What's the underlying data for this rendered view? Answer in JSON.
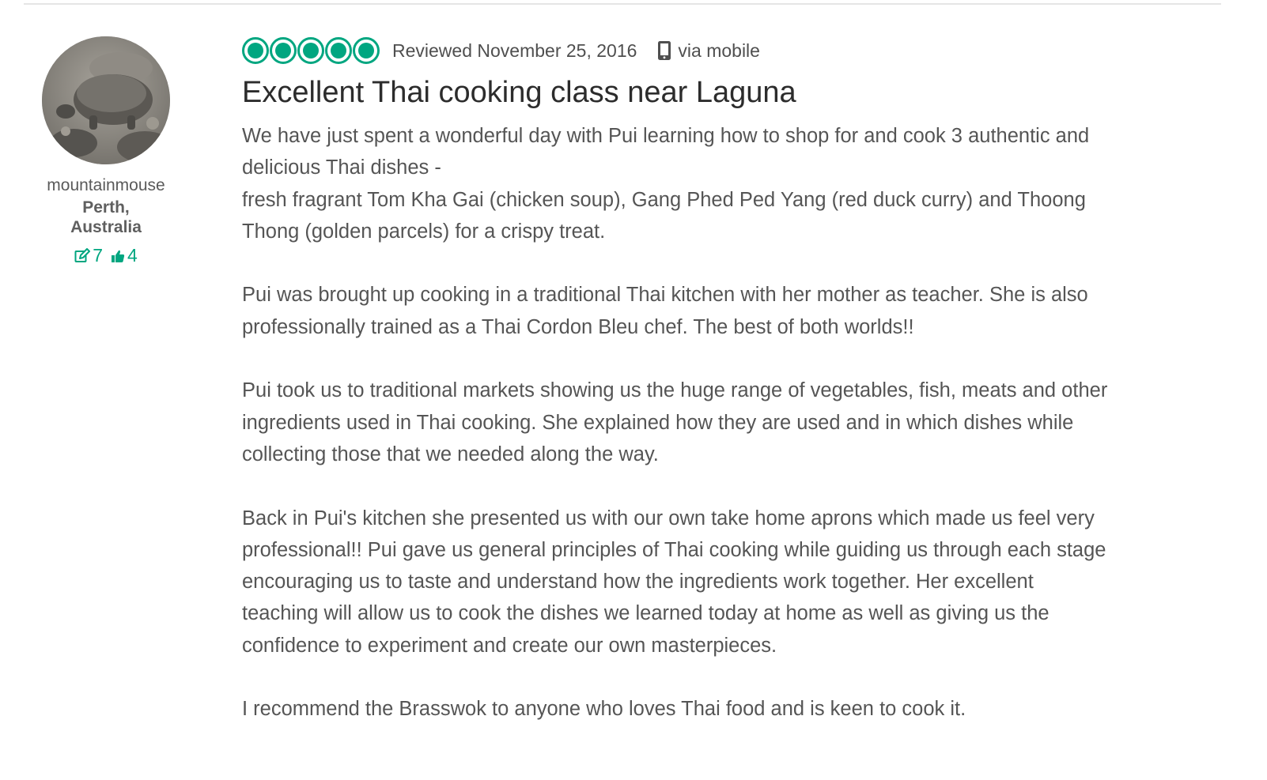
{
  "reviewer": {
    "username": "mountainmouse",
    "location": "Perth, Australia",
    "review_count": "7",
    "helpful_votes": "4"
  },
  "review": {
    "rating": 5,
    "date": "Reviewed November 25, 2016",
    "via": "via mobile",
    "title": "Excellent Thai cooking class near Laguna",
    "paragraphs": [
      "We have just spent a wonderful day with Pui learning how to shop for and cook 3 authentic and delicious Thai dishes -\nfresh fragrant Tom Kha Gai (chicken soup), Gang Phed Ped Yang (red duck curry) and Thoong Thong (golden parcels) for a crispy treat.",
      "Pui was brought up cooking in a traditional Thai kitchen with her mother as teacher. She is also professionally trained as a Thai Cordon Bleu chef. The best of both worlds!!",
      "Pui took us to traditional markets showing us the huge range of vegetables, fish, meats and other ingredients used in Thai cooking. She explained how they are used and in which dishes while collecting those that we needed along the way.",
      "Back in Pui's kitchen she presented us with our own take home aprons which made us feel very professional!! Pui gave us general principles of Thai cooking while guiding us through each stage encouraging us to taste and understand how the ingredients work together. Her excellent teaching will allow us to cook the dishes we learned today at home as well as giving us the confidence to experiment and create our own masterpieces.",
      "I recommend the Brasswok to anyone who loves Thai food and is keen to cook it."
    ]
  },
  "icons": {
    "bubble": "rating-bubble-icon",
    "mobile": "mobile-phone-icon",
    "reviews": "pencil-icon",
    "helpful": "thumbs-up-icon"
  },
  "colors": {
    "accent": "#00a680",
    "text": "#4a4a4a",
    "title": "#2c2c2c"
  }
}
